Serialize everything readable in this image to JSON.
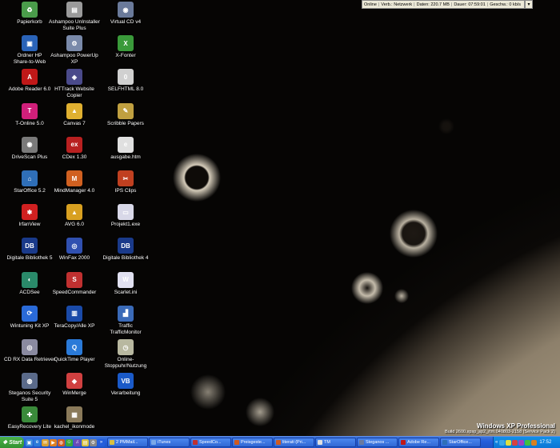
{
  "desktop": {
    "icons": [
      {
        "label": "Papierkorb",
        "icon": "recycle-bin-icon",
        "color": "#4a9c4a",
        "glyph": "♻"
      },
      {
        "label": "Ordner HP\nShare-to-Web",
        "icon": "folder-share-icon",
        "color": "#2a63b8",
        "glyph": "▣"
      },
      {
        "label": "Adobe Reader 6.0",
        "icon": "adobe-reader-icon",
        "color": "#c01818",
        "glyph": "A"
      },
      {
        "label": "T-Online 5.0",
        "icon": "t-online-icon",
        "color": "#d01f7a",
        "glyph": "T"
      },
      {
        "label": "DriveScan Plus",
        "icon": "drivescan-icon",
        "color": "#7a7a7a",
        "glyph": "◉"
      },
      {
        "label": "StarOffice 5.2",
        "icon": "staroffice-icon",
        "color": "#2f6fb8",
        "glyph": "⌂"
      },
      {
        "label": "IrfanView",
        "icon": "irfanview-icon",
        "color": "#d02020",
        "glyph": "✱"
      },
      {
        "label": "Digitale Bibliothek 5",
        "icon": "digitale-bibliothek-icon",
        "color": "#1a3a8a",
        "glyph": "DB"
      },
      {
        "label": "ACDSee",
        "icon": "acdsee-icon",
        "color": "#2a8a6a",
        "glyph": "◐"
      },
      {
        "label": "Wintuning Kit XP",
        "icon": "wintuning-icon",
        "color": "#2a6ad8",
        "glyph": "⟳"
      },
      {
        "label": "CD RX Data Retriever",
        "icon": "cd-retriever-icon",
        "color": "#8a8aa0",
        "glyph": "◎"
      },
      {
        "label": "Steganos Security\nSuite 5",
        "icon": "steganos-icon",
        "color": "#5a6a8a",
        "glyph": "◍"
      },
      {
        "label": "EasyRecovery Lite",
        "icon": "easyrecovery-icon",
        "color": "#3a8a3a",
        "glyph": "✚"
      },
      {
        "label": "Ashampoo UnInstaller\nSuite Plus",
        "icon": "ashampoo-uninstaller-icon",
        "color": "#9a9a9a",
        "glyph": "▤"
      },
      {
        "label": "Ashampoo PowerUp XP",
        "icon": "ashampoo-powerup-icon",
        "color": "#7a8aaa",
        "glyph": "⚙"
      },
      {
        "label": "HTTrack Website\nCopier",
        "icon": "httrack-icon",
        "color": "#4a4a8a",
        "glyph": "◈"
      },
      {
        "label": "Canvas 7",
        "icon": "canvas-icon",
        "color": "#e0b030",
        "glyph": "▲"
      },
      {
        "label": "CDex 1.30",
        "icon": "cdex-icon",
        "color": "#b82020",
        "glyph": "ex"
      },
      {
        "label": "MindManager 4.0",
        "icon": "mindmanager-icon",
        "color": "#d06020",
        "glyph": "M"
      },
      {
        "label": "AVG 6.0",
        "icon": "avg-icon",
        "color": "#d8a020",
        "glyph": "▲"
      },
      {
        "label": "WinFax 2000",
        "icon": "winfax-icon",
        "color": "#3050b0",
        "glyph": "◎"
      },
      {
        "label": "SpeedCommander",
        "icon": "speedcommander-icon",
        "color": "#c03030",
        "glyph": "S"
      },
      {
        "label": "TeraCopy/Alle XP",
        "icon": "teracopy-icon",
        "color": "#1a4aa8",
        "glyph": "▥"
      },
      {
        "label": "QuickTime Player",
        "icon": "quicktime-icon",
        "color": "#2a7ad8",
        "glyph": "Q"
      },
      {
        "label": "WinMerge",
        "icon": "winmerge-icon",
        "color": "#d04040",
        "glyph": "◆"
      },
      {
        "label": "kachel_ikonmode",
        "icon": "kachel-icon",
        "color": "#8a7a5a",
        "glyph": "▦"
      },
      {
        "label": "Virtual CD v4",
        "icon": "virtual-cd-icon",
        "color": "#6a7a9a",
        "glyph": "◉"
      },
      {
        "label": "X-Fonter",
        "icon": "x-fonter-icon",
        "color": "#3a9a3a",
        "glyph": "X"
      },
      {
        "label": "SELFHTML 8.0",
        "icon": "selfhtml-icon",
        "color": "#d0d0d0",
        "glyph": "0"
      },
      {
        "label": "Scribble Papers",
        "icon": "scribble-papers-icon",
        "color": "#c0a040",
        "glyph": "✎"
      },
      {
        "label": "ausgabe.htm",
        "icon": "html-file-icon",
        "color": "#e0e0e0",
        "glyph": "e"
      },
      {
        "label": "IPS Clips",
        "icon": "ips-clips-icon",
        "color": "#c04020",
        "glyph": "✂"
      },
      {
        "label": "Projekt1.exe",
        "icon": "exe-file-icon",
        "color": "#d8d8e8",
        "glyph": "▭"
      },
      {
        "label": "Digitale Bibliothek 4",
        "icon": "digitale-bibliothek-4-icon",
        "color": "#1a3a8a",
        "glyph": "DB"
      },
      {
        "label": "Scarlet.ini",
        "icon": "ini-file-icon",
        "color": "#e0e0f0",
        "glyph": "W"
      },
      {
        "label": "Traffic\nTrafficMonitor",
        "icon": "traffic-monitor-icon",
        "color": "#3a6ab8",
        "glyph": "▟"
      },
      {
        "label": "Online-Stoppuhr/Nutzung",
        "icon": "stopwatch-icon",
        "color": "#b8b8a0",
        "glyph": "◷"
      },
      {
        "label": "Verarbeitung",
        "icon": "vb-icon",
        "color": "#1a5ac8",
        "glyph": "VB"
      }
    ]
  },
  "net_meter": {
    "status": "Online",
    "connection": "Verb.: Netzwerk",
    "data": "Daten: 220.7 MB",
    "duration": "Dauer: 07:59:01",
    "speed": "Geschw.: 0 kb/s",
    "dropdown_glyph": "▾"
  },
  "watermark": {
    "title": "Windows XP Professional",
    "build": "Build 2600.xpsp_sp2_rtm.040803-2158 (Service Pack 2)"
  },
  "taskbar": {
    "start_label": "Start",
    "start_glyph": "❖",
    "quicklaunch": [
      {
        "icon": "desktop-icon",
        "color": "#3a8ad8",
        "glyph": "▣"
      },
      {
        "icon": "ie-icon",
        "color": "#2a7ad8",
        "glyph": "e"
      },
      {
        "icon": "outlook-icon",
        "color": "#d8a030",
        "glyph": "✉"
      },
      {
        "icon": "media-player-icon",
        "color": "#e08020",
        "glyph": "▶"
      },
      {
        "icon": "firefox-icon",
        "color": "#d05a20",
        "glyph": "◍"
      },
      {
        "icon": "messenger-icon",
        "color": "#3aa83a",
        "glyph": "☺"
      },
      {
        "icon": "music-icon",
        "color": "#6a4ab8",
        "glyph": "♫"
      },
      {
        "icon": "explorer-icon",
        "color": "#d8c040",
        "glyph": "▤"
      },
      {
        "icon": "control-icon",
        "color": "#888",
        "glyph": "⚙"
      },
      {
        "icon": "more-icon",
        "color": "#245edc",
        "glyph": "»"
      }
    ],
    "tasks": [
      {
        "label": "2 PMMail...",
        "color": "#d8c040"
      },
      {
        "label": "iTunes",
        "color": "#7aa8e8"
      },
      {
        "label": "SpeedCo...",
        "color": "#c03030"
      },
      {
        "label": "Preisgeste...",
        "color": "#d05a20"
      },
      {
        "label": "literati (Pri...",
        "color": "#d05a20"
      },
      {
        "label": "TM",
        "color": "#e0e0e0"
      },
      {
        "label": "Steganos ...",
        "color": "#6a7aa0"
      },
      {
        "label": "Adobe Re...",
        "color": "#c01818"
      },
      {
        "label": "StarOffice...",
        "color": "#2f6fb8"
      }
    ],
    "tray": {
      "chevron": "«",
      "icons": [
        "#3aa8e8",
        "#e0e040",
        "#d84040",
        "#a040c0",
        "#40c040",
        "#d88020"
      ],
      "clock": "17:52"
    }
  }
}
